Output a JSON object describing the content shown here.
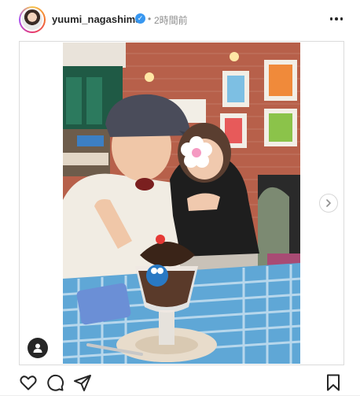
{
  "header": {
    "username": "yuumi_nagashima",
    "verified_icon": "verified-badge-icon",
    "separator": "•",
    "timestamp": "2時間前",
    "more_icon": "more-options-icon"
  },
  "media": {
    "carousel_next_icon": "chevron-right-icon",
    "tag_icon": "user-tag-icon"
  },
  "actions": {
    "like_icon": "heart-icon",
    "comment_icon": "comment-icon",
    "share_icon": "send-icon",
    "save_icon": "bookmark-icon"
  },
  "colors": {
    "text_primary": "#262626",
    "text_secondary": "#8e8e8e",
    "verified": "#3897f0",
    "border": "#dbdbdb"
  }
}
